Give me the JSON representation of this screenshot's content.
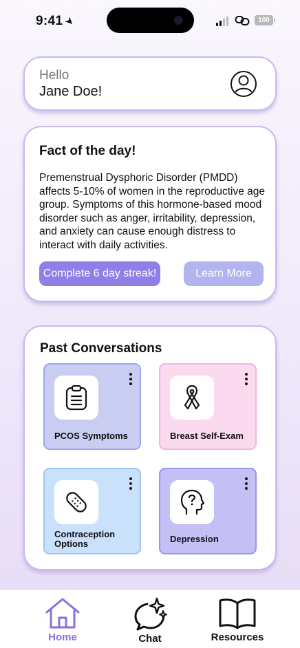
{
  "status_bar": {
    "time": "9:41",
    "battery": "100"
  },
  "greeting": {
    "hello": "Hello",
    "name": "Jane Doe!"
  },
  "fact": {
    "title": "Fact of the day!",
    "body": "Premenstrual Dysphoric Disorder (PMDD) affects 5-10% of women in the reproductive age group. Symptoms of this hormone-based mood disorder such as anger, irritability, depression, and anxiety can cause enough distress to interact with daily activities.",
    "streak_button": "Complete 6 day streak!",
    "learn_button": "Learn More"
  },
  "past": {
    "title": "Past Conversations",
    "tiles": [
      {
        "label": "PCOS Symptoms",
        "icon": "clipboard-icon",
        "color": "#c9cdf1"
      },
      {
        "label": "Breast Self-Exam",
        "icon": "ribbon-icon",
        "color": "#fbd9ef"
      },
      {
        "label": "Contraception Options",
        "icon": "bandage-icon",
        "color": "#c9e1fb"
      },
      {
        "label": "Depression",
        "icon": "head-question-icon",
        "color": "#c4bff5"
      }
    ]
  },
  "nav": {
    "items": [
      {
        "label": "Home",
        "icon": "home-icon",
        "active": true
      },
      {
        "label": "Chat",
        "icon": "chat-sparkle-icon",
        "active": false
      },
      {
        "label": "Resources",
        "icon": "book-icon",
        "active": false
      }
    ]
  },
  "colors": {
    "accent": "#8a6fe0",
    "card_border": "#c9b8ee",
    "streak_button": "#8f7fe6",
    "learn_button": "#b3b4ef"
  }
}
